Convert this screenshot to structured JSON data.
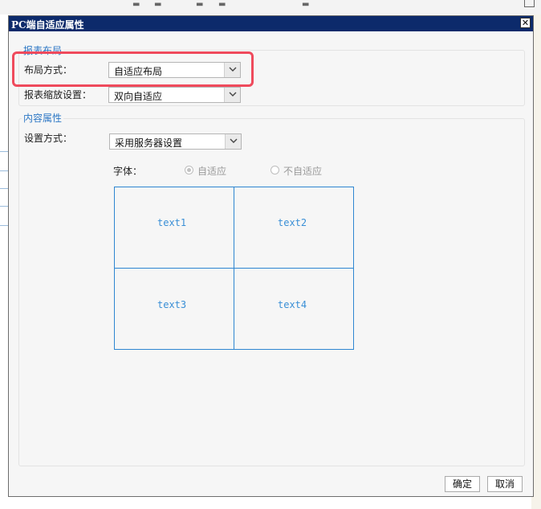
{
  "dialog": {
    "title": "PC端自适应属性",
    "close_glyph": "✕"
  },
  "layout_section": {
    "title": "报表布局",
    "layout_mode_label": "布局方式：",
    "layout_mode_value": "自适应布局",
    "scale_label": "报表缩放设置：",
    "scale_value": "双向自适应"
  },
  "content_section": {
    "title": "内容属性",
    "setting_label": "设置方式：",
    "setting_value": "采用服务器设置",
    "font_label": "字体：",
    "font_options": [
      {
        "label": "自适应",
        "checked": true
      },
      {
        "label": "不自适应",
        "checked": false
      }
    ],
    "preview_cells": [
      "text1",
      "text2",
      "text3",
      "text4"
    ]
  },
  "footer": {
    "ok_label": "确定",
    "cancel_label": "取消"
  },
  "colors": {
    "titlebar": "#0c2a6b",
    "section_title": "#2e78c5",
    "highlight": "#ef4a5c",
    "grid": "#2e86d1"
  },
  "icons": [
    "close-icon",
    "chevron-down-icon",
    "radio-icon"
  ]
}
